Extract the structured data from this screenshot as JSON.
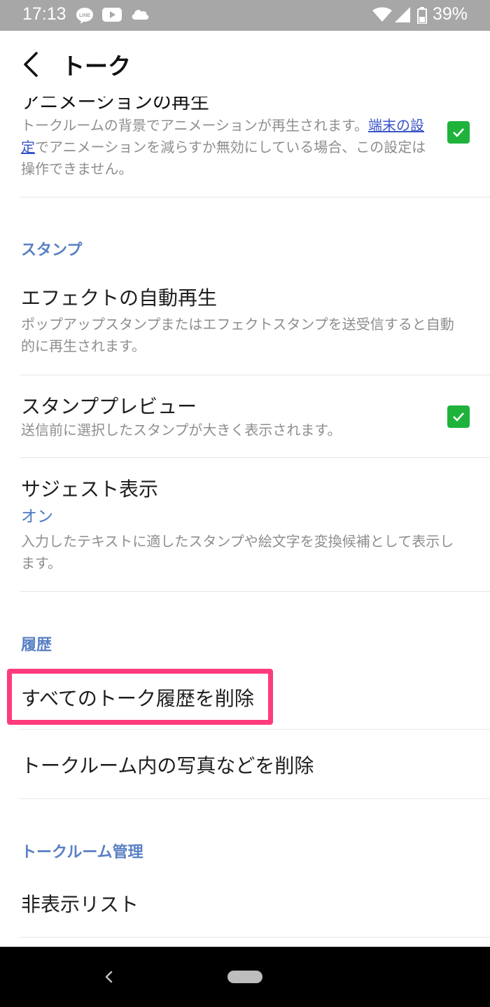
{
  "status_bar": {
    "time": "17:13",
    "battery": "39%",
    "icons": [
      "line-icon",
      "youtube-icon",
      "cloud-icon",
      "wifi-icon",
      "signal-icon",
      "battery-icon"
    ]
  },
  "header": {
    "title": "トーク"
  },
  "animation_setting": {
    "title_cut": "アニメーションの再生",
    "desc_part1": "トークルームの背景でアニメーションが再生されます。",
    "desc_link": "端末の設定",
    "desc_part2": "でアニメーションを減らすか無効にしている場合、この設定は操作できません。",
    "checked": true
  },
  "stamp_section": {
    "header": "スタンプ",
    "effect_autoplay": {
      "title": "エフェクトの自動再生",
      "desc": "ポップアップスタンプまたはエフェクトスタンプを送受信すると自動的に再生されます。"
    },
    "stamp_preview": {
      "title": "スタンププレビュー",
      "desc": "送信前に選択したスタンプが大きく表示されます。",
      "checked": true
    },
    "suggest": {
      "title": "サジェスト表示",
      "value": "オン",
      "desc": "入力したテキストに適したスタンプや絵文字を変換候補として表示します。"
    }
  },
  "history_section": {
    "header": "履歴",
    "delete_all": "すべてのトーク履歴を削除",
    "delete_media": "トークルーム内の写真などを削除"
  },
  "room_section": {
    "header": "トークルーム管理",
    "hidden_list": "非表示リスト"
  },
  "colors": {
    "accent_blue": "#5a80c4",
    "checkbox_green": "#1fb33c",
    "highlight_pink": "#ff3b7b"
  }
}
